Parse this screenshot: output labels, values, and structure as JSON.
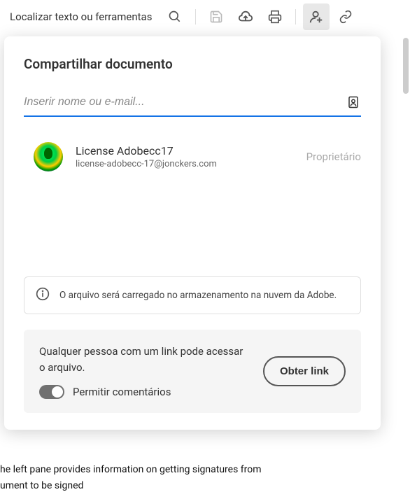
{
  "toolbar": {
    "search_placeholder": "Localizar texto ou ferramentas"
  },
  "popup": {
    "title": "Compartilhar documento",
    "input_placeholder": "Inserir nome ou e-mail...",
    "user": {
      "name": "License Adobecc17",
      "email": "license-adobecc-17@jonckers.com",
      "role": "Proprietário"
    },
    "info_message": "O arquivo será carregado no armazenamento na nuvem da Adobe.",
    "link_section": {
      "description": "Qualquer pessoa com um link pode acessar o arquivo.",
      "toggle_label": "Permitir comentários",
      "button_label": "Obter link"
    }
  },
  "background": {
    "line1": "he left pane provides information on getting signatures from",
    "line2": "ument to be signed"
  }
}
